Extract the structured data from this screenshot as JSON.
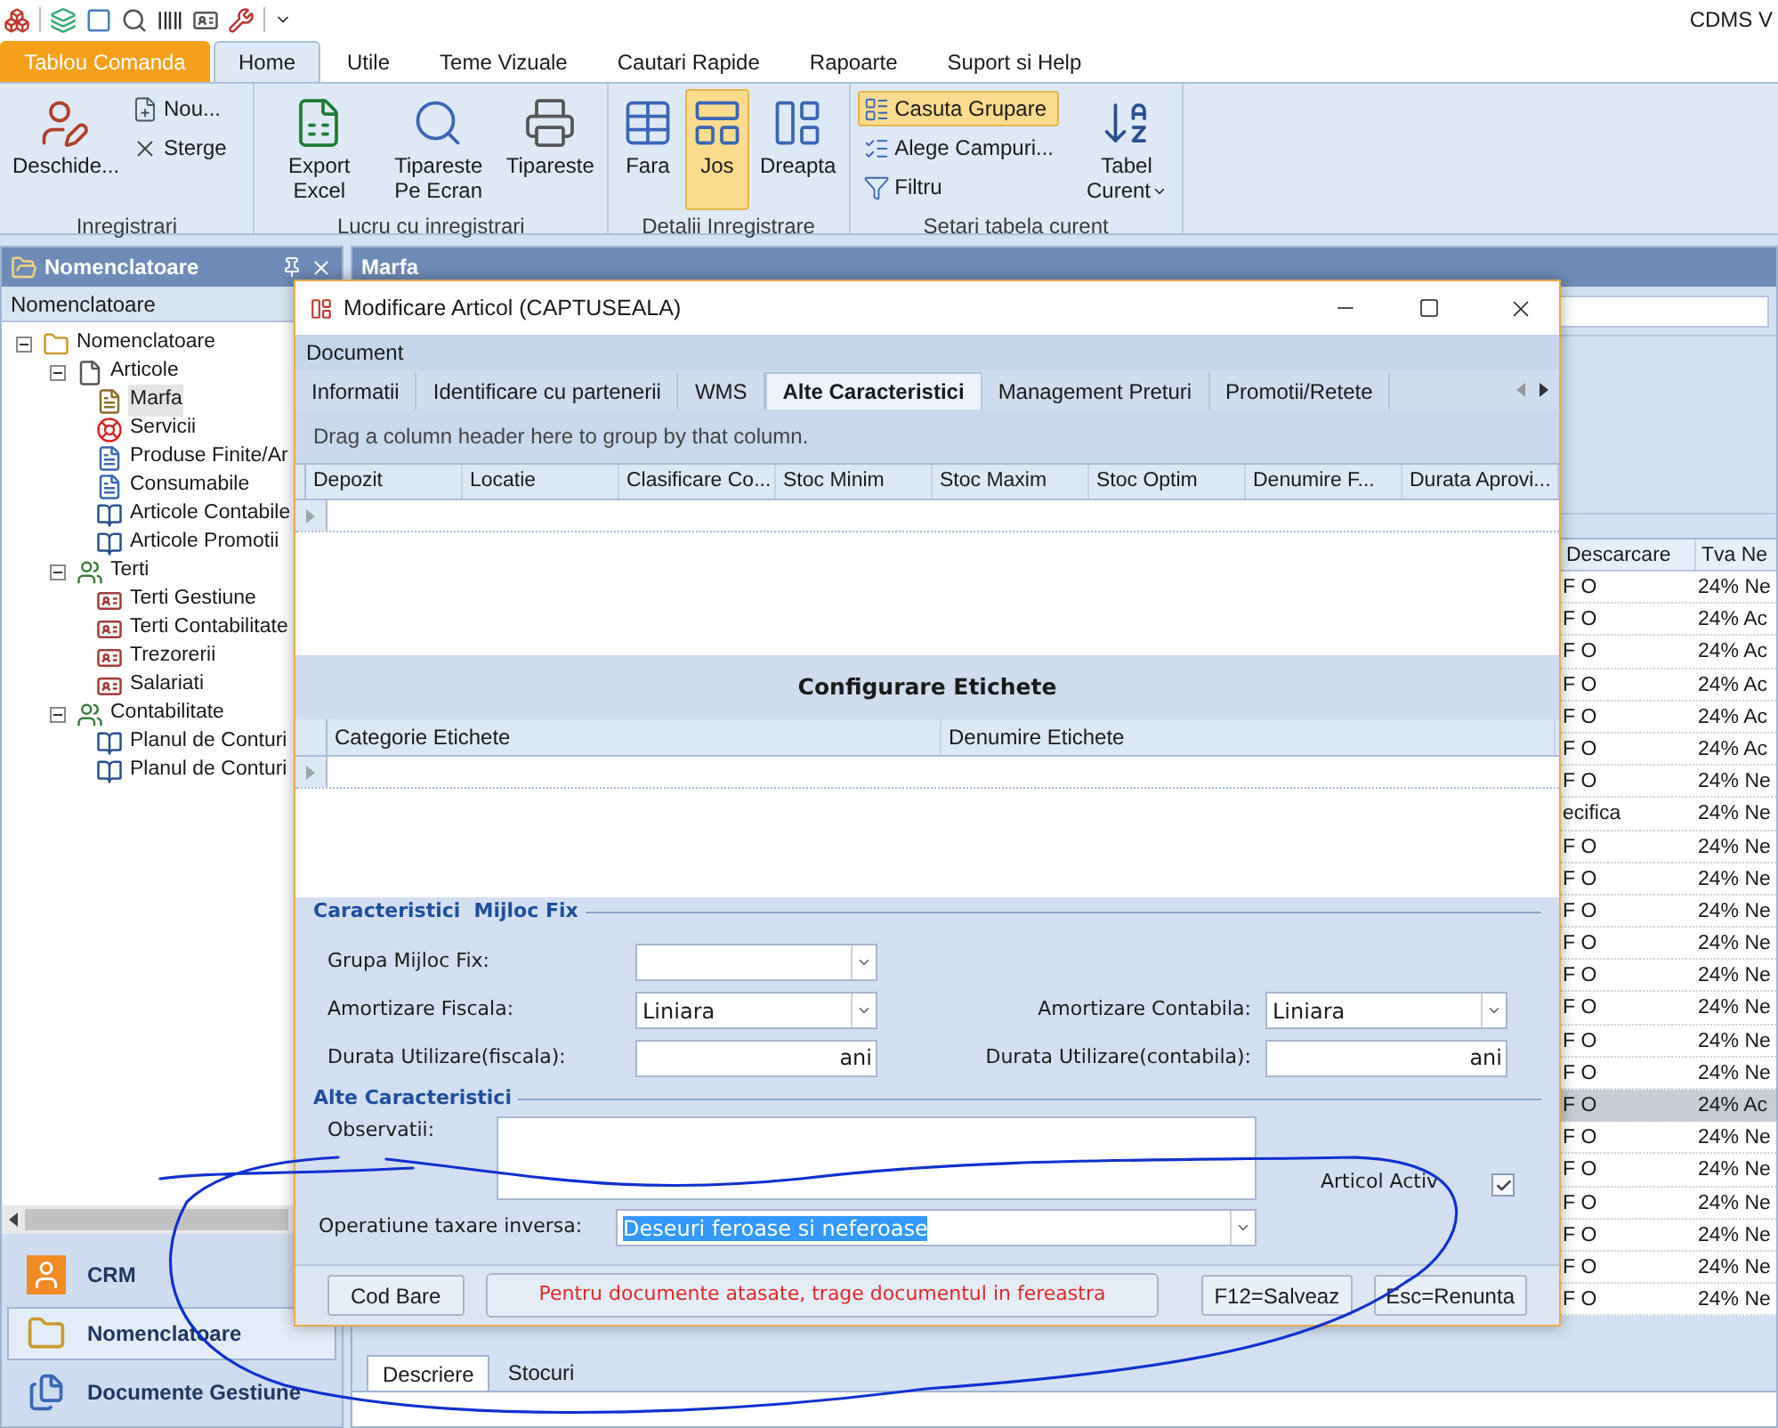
{
  "app": {
    "title": "CDMS V"
  },
  "ribbon_tabs": [
    {
      "label": "Tablou Comanda",
      "kind": "app",
      "selected": false
    },
    {
      "label": "Home",
      "kind": "tab",
      "selected": true
    },
    {
      "label": "Utile",
      "kind": "tab",
      "selected": false
    },
    {
      "label": "Teme Vizuale",
      "kind": "tab",
      "selected": false
    },
    {
      "label": "Cautari Rapide",
      "kind": "tab",
      "selected": false
    },
    {
      "label": "Rapoarte",
      "kind": "tab",
      "selected": false
    },
    {
      "label": "Suport si Help",
      "kind": "tab",
      "selected": false
    }
  ],
  "ribbon_groups": [
    {
      "label": "Inregistrari",
      "buttons": [
        {
          "label": "Deschide...",
          "kind": "large",
          "selected": false
        },
        {
          "label": "Nou...",
          "kind": "small",
          "selected": false
        },
        {
          "label": "Sterge",
          "kind": "small",
          "selected": false
        }
      ]
    },
    {
      "label": "Lucru cu inregistrari",
      "buttons": [
        {
          "label": "Export Excel",
          "kind": "large",
          "selected": false
        },
        {
          "label": "Tipareste Pe Ecran",
          "kind": "large",
          "selected": false
        },
        {
          "label": "Tipareste",
          "kind": "large",
          "selected": false
        }
      ]
    },
    {
      "label": "Detalii Inregistrare",
      "buttons": [
        {
          "label": "Fara",
          "kind": "large",
          "selected": false
        },
        {
          "label": "Jos",
          "kind": "large",
          "selected": true
        },
        {
          "label": "Dreapta",
          "kind": "large",
          "selected": false
        }
      ]
    },
    {
      "label": "Setari tabela curent",
      "buttons": [
        {
          "label": "Casuta Grupare",
          "kind": "small",
          "selected": true
        },
        {
          "label": "Alege Campuri...",
          "kind": "small",
          "selected": false
        },
        {
          "label": "Filtru",
          "kind": "small",
          "selected": false
        },
        {
          "label": "Tabel Curent",
          "kind": "menu",
          "selected": false
        }
      ]
    }
  ],
  "left_panel": {
    "title": "Nomenclatoare",
    "subheader": "Nomenclatoare",
    "tree": [
      {
        "label": "Nomenclatoare",
        "kind": "folder",
        "expanded": true,
        "children": [
          {
            "label": "Articole",
            "kind": "page",
            "expanded": true,
            "children": [
              {
                "label": "Marfa",
                "kind": "list",
                "selected": true
              },
              {
                "label": "Servicii",
                "kind": "ring",
                "selected": false
              },
              {
                "label": "Produse Finite/Ar",
                "kind": "doc",
                "selected": false
              },
              {
                "label": "Consumabile",
                "kind": "doc",
                "selected": false
              },
              {
                "label": "Articole Contabile",
                "kind": "book",
                "selected": false
              },
              {
                "label": "Articole Promotii",
                "kind": "book",
                "selected": false
              }
            ]
          },
          {
            "label": "Terti",
            "kind": "people",
            "expanded": true,
            "children": [
              {
                "label": "Terti Gestiune",
                "kind": "card",
                "selected": false
              },
              {
                "label": "Terti Contabilitate",
                "kind": "card",
                "selected": false
              },
              {
                "label": "Trezorerii",
                "kind": "card",
                "selected": false
              },
              {
                "label": "Salariati",
                "kind": "card",
                "selected": false
              }
            ]
          },
          {
            "label": "Contabilitate",
            "kind": "people",
            "expanded": true,
            "children": [
              {
                "label": "Planul de Conturi",
                "kind": "book",
                "selected": false
              },
              {
                "label": "Planul de Conturi",
                "kind": "book",
                "selected": false
              }
            ]
          }
        ]
      }
    ],
    "nav": [
      {
        "label": "CRM",
        "selected": false
      },
      {
        "label": "Nomenclatoare",
        "selected": true
      },
      {
        "label": "Documente Gestiune",
        "selected": false
      }
    ]
  },
  "main": {
    "title": "Marfa",
    "table": {
      "columns": [
        "Descarcare",
        "Tva Ne"
      ],
      "rows": [
        {
          "cells": [
            "F O",
            "24% Ne"
          ],
          "selected": false
        },
        {
          "cells": [
            "F O",
            "24% Ac"
          ],
          "selected": false
        },
        {
          "cells": [
            "F O",
            "24% Ac"
          ],
          "selected": false
        },
        {
          "cells": [
            "F O",
            "24% Ac"
          ],
          "selected": false
        },
        {
          "cells": [
            "F O",
            "24% Ac"
          ],
          "selected": false
        },
        {
          "cells": [
            "F O",
            "24% Ac"
          ],
          "selected": false
        },
        {
          "cells": [
            "F O",
            "24% Ne"
          ],
          "selected": false
        },
        {
          "cells": [
            "ecifica",
            "24% Ne"
          ],
          "selected": false
        },
        {
          "cells": [
            "F O",
            "24% Ne"
          ],
          "selected": false
        },
        {
          "cells": [
            "F O",
            "24% Ne"
          ],
          "selected": false
        },
        {
          "cells": [
            "F O",
            "24% Ne"
          ],
          "selected": false
        },
        {
          "cells": [
            "F O",
            "24% Ne"
          ],
          "selected": false
        },
        {
          "cells": [
            "F O",
            "24% Ne"
          ],
          "selected": false
        },
        {
          "cells": [
            "F O",
            "24% Ne"
          ],
          "selected": false
        },
        {
          "cells": [
            "F O",
            "24% Ne"
          ],
          "selected": false
        },
        {
          "cells": [
            "F O",
            "24% Ne"
          ],
          "selected": false
        },
        {
          "cells": [
            "F O",
            "24% Ac"
          ],
          "selected": true
        },
        {
          "cells": [
            "F O",
            "24% Ne"
          ],
          "selected": false
        },
        {
          "cells": [
            "F O",
            "24% Ne"
          ],
          "selected": false
        },
        {
          "cells": [
            "F O",
            "24% Ne"
          ],
          "selected": false
        },
        {
          "cells": [
            "F O",
            "24% Ne"
          ],
          "selected": false
        },
        {
          "cells": [
            "F O",
            "24% Ne"
          ],
          "selected": false
        },
        {
          "cells": [
            "F O",
            "24% Ne"
          ],
          "selected": false
        }
      ]
    },
    "bottom_tabs": [
      {
        "label": "Descriere",
        "selected": true
      },
      {
        "label": "Stocuri",
        "selected": false
      }
    ]
  },
  "dialog": {
    "title": "Modificare Articol (CAPTUSEALA)",
    "menu": [
      "Document"
    ],
    "tabs": [
      {
        "label": "Informatii",
        "selected": false
      },
      {
        "label": "Identificare cu partenerii",
        "selected": false
      },
      {
        "label": "WMS",
        "selected": false
      },
      {
        "label": "Alte Caracteristici",
        "selected": true
      },
      {
        "label": "Management Preturi",
        "selected": false
      },
      {
        "label": "Promotii/Retete",
        "selected": false
      }
    ],
    "group_hint": "Drag a column header here to group by that column.",
    "grid_columns": [
      "Depozit",
      "Locatie",
      "Clasificare Co...",
      "Stoc Minim",
      "Stoc Maxim",
      "Stoc Optim",
      "Denumire F...",
      "Durata Aprovi..."
    ],
    "labels_title": "Configurare Etichete",
    "labels_columns": [
      "Categorie Etichete",
      "Denumire Etichete"
    ],
    "fixed_asset": {
      "legend": "Caracteristici  Mijloc Fix",
      "fields": [
        {
          "label": "Grupa Mijloc Fix:",
          "kind": "combo"
        },
        {
          "label": "Amortizare Fiscala:",
          "kind": "combo",
          "value": "Liniara"
        },
        {
          "label": "Amortizare Contabila:",
          "kind": "combo",
          "value": "Liniara"
        },
        {
          "label": "Durata Utilizare(fiscala):",
          "kind": "unit",
          "value": "ani"
        },
        {
          "label": "Durata Utilizare(contabila):",
          "kind": "unit",
          "value": "ani"
        }
      ]
    },
    "other": {
      "legend": "Alte Caracteristici",
      "notes_label": "Observatii:",
      "active_label": "Articol Activ",
      "active_checked": true,
      "reverse_label": "Operatiune taxare inversa:",
      "reverse_value": "Deseuri feroase si neferoase",
      "reverse_highlighted": true
    },
    "footer": {
      "barcode": "Cod Bare",
      "message": "Pentru documente atasate, trage documentul in fereastra",
      "save": "F12=Salveaz",
      "cancel": "Esc=Renunta"
    }
  }
}
